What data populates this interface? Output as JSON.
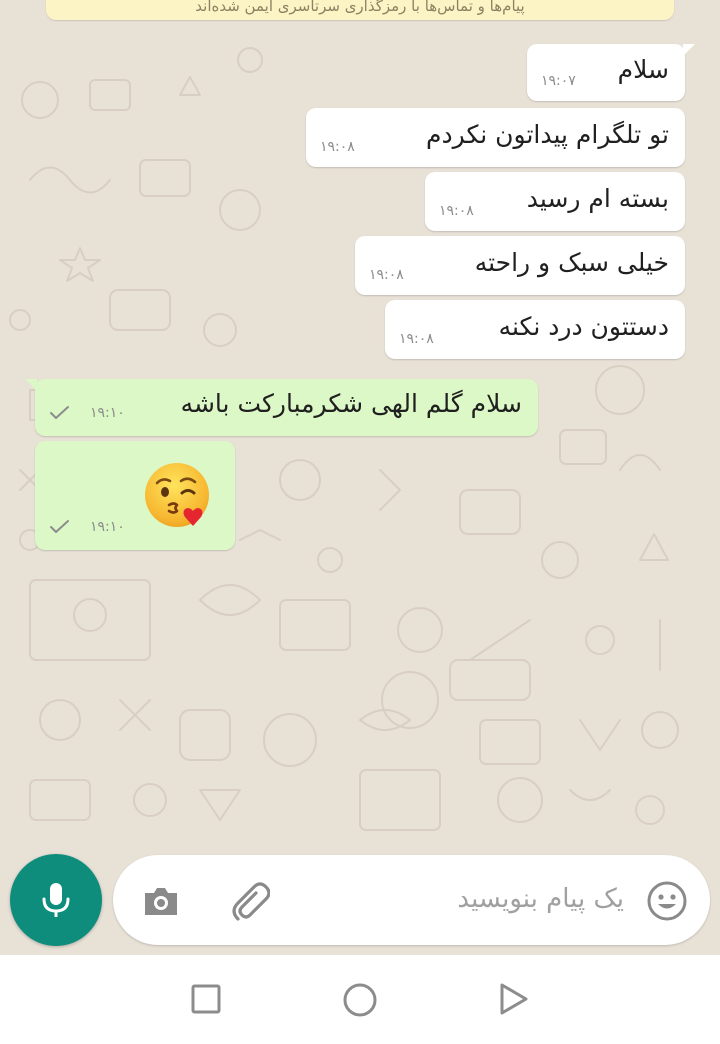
{
  "banner": {
    "text": "پیام‌ها و تماس‌ها با رمزگذاری سرتاسری ایمن شده‌اند"
  },
  "messages": [
    {
      "direction": "incoming",
      "text": "سلام",
      "time": "۱۹:۰۷"
    },
    {
      "direction": "incoming",
      "text": "تو تلگرام پیداتون نکردم",
      "time": "۱۹:۰۸"
    },
    {
      "direction": "incoming",
      "text": "بسته ام رسید",
      "time": "۱۹:۰۸"
    },
    {
      "direction": "incoming",
      "text": "خیلی سبک و راحته",
      "time": "۱۹:۰۸"
    },
    {
      "direction": "incoming",
      "text": "دستتون درد نکنه",
      "time": "۱۹:۰۸"
    },
    {
      "direction": "outgoing",
      "text": "سلام گلم الهی شکرمبارکت باشه",
      "time": "۱۹:۱۰",
      "status": "sent"
    },
    {
      "direction": "outgoing",
      "emoji": "face-blowing-a-kiss",
      "time": "۱۹:۱۰",
      "status": "sent"
    }
  ],
  "composer": {
    "placeholder": "یک پیام بنویسید",
    "icons": [
      "emoji-icon",
      "attachment-icon",
      "camera-icon",
      "microphone-icon"
    ]
  },
  "nav": {
    "buttons": [
      "recents-button",
      "home-button",
      "back-button"
    ]
  },
  "colors": {
    "chat_background": "#e8e1d6",
    "incoming_bubble": "#ffffff",
    "outgoing_bubble": "#dcf8c6",
    "mic_button": "#0e8d7c",
    "banner": "#fdf4c5"
  }
}
